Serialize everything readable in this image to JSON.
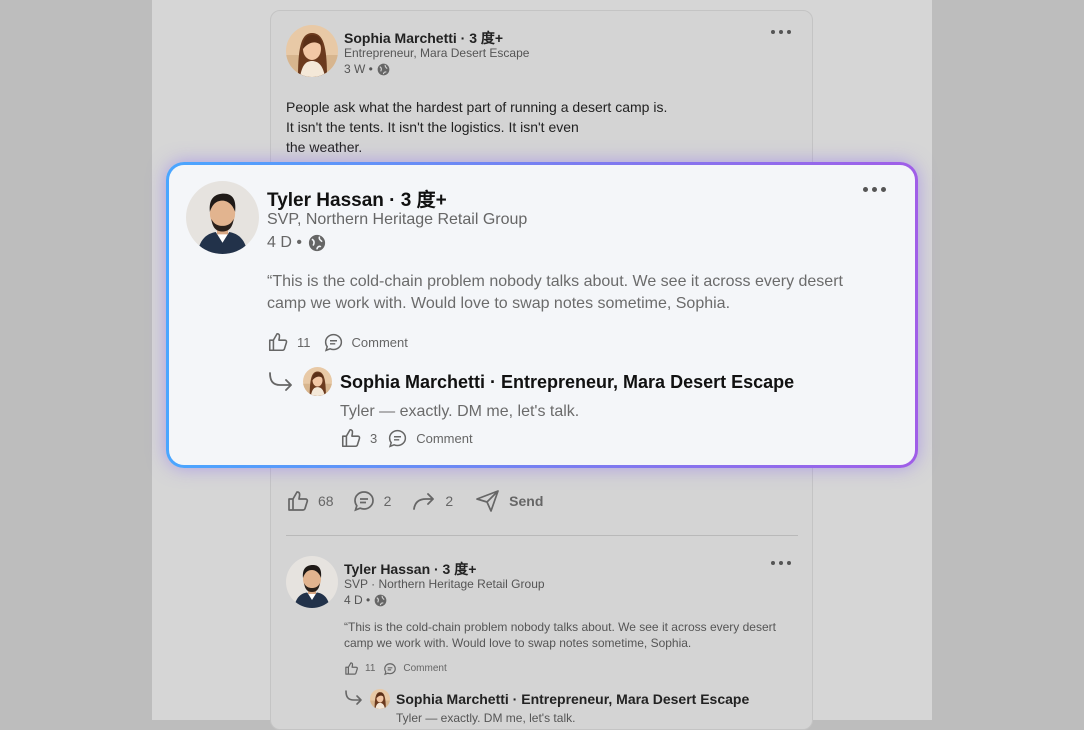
{
  "post": {
    "author": "Sophia Marchetti · 3 度+",
    "headline": "Entrepreneur, Mara Desert Escape",
    "age": "3 W •",
    "text_lines": [
      "People ask what the hardest part of running a desert camp is.",
      "It isn't the tents. It isn't the logistics. It isn't even",
      "the weather."
    ],
    "actions": {
      "like_count": "68",
      "comment_count": "2",
      "share_count": "2",
      "send_label": "Send"
    }
  },
  "highlight": {
    "comment": {
      "author": "Tyler Hassan · 3 度+",
      "headline": "SVP, Northern Heritage Retail Group",
      "age": "4 D •",
      "text_line1": "“This is the cold-chain problem nobody talks about. We see it across every desert",
      "text_line2": "camp we work with. Would love to swap notes sometime, Sophia.",
      "like_count": "11",
      "comment_label": "Comment"
    },
    "reply": {
      "author": "Sophia Marchetti · Entrepreneur, Mara Desert Escape",
      "text": "Tyler — exactly. DM me, let's talk.",
      "like_count": "3",
      "comment_label": "Comment"
    }
  },
  "comment_bg": {
    "author": "Tyler Hassan · 3 度+",
    "headline": "SVP · Northern Heritage Retail Group",
    "age": "4 D •",
    "text_line1": "“This is the cold-chain problem nobody talks about. We see it across every desert",
    "text_line2": "camp we work with. Would love to swap notes sometime, Sophia.",
    "like_count": "11",
    "comment_label": "Comment",
    "reply": {
      "author": "Sophia Marchetti · Entrepreneur, Mara Desert Escape",
      "text": "Tyler — exactly. DM me, let's talk."
    }
  },
  "icons": [
    "globe-icon",
    "like-icon",
    "comment-icon",
    "share-icon",
    "send-icon",
    "more-icon",
    "reply-arrow-icon"
  ],
  "colors": {
    "highlight_border_start": "#4aa6ff",
    "highlight_border_end": "#a05ee8",
    "highlight_bg": "#f4f6f9",
    "page_dim": "#d6d6d6"
  }
}
